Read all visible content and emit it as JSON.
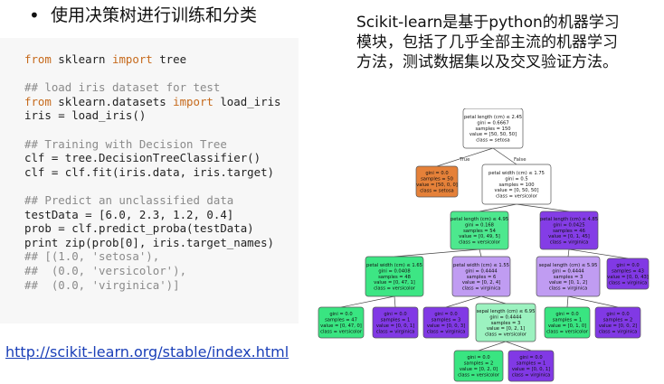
{
  "slide": {
    "bullet": "•",
    "title": "使用决策树进行训练和分类",
    "description_lines": [
      "Scikit-learn是基于python的机器学习",
      "模块，包括了几乎全部主流的机器学习",
      "方法，测试数据集以及交叉验证方法。"
    ],
    "link": "http://scikit-learn.org/stable/index.html"
  },
  "code": [
    [
      {
        "t": "from",
        "c": "kw"
      },
      {
        "t": " sklearn "
      },
      {
        "t": "import",
        "c": "kw"
      },
      {
        "t": " tree"
      }
    ],
    [],
    [
      {
        "t": "## load iris dataset for test",
        "c": "cm"
      }
    ],
    [
      {
        "t": "from",
        "c": "kw"
      },
      {
        "t": " sklearn.datasets "
      },
      {
        "t": "import",
        "c": "kw"
      },
      {
        "t": " load_iris"
      }
    ],
    [
      {
        "t": "iris = load_iris()"
      }
    ],
    [],
    [
      {
        "t": "## Training with Decision Tree",
        "c": "cm"
      }
    ],
    [
      {
        "t": "clf = tree.DecisionTreeClassifier()"
      }
    ],
    [
      {
        "t": "clf = clf.fit(iris.data, iris.target)"
      }
    ],
    [],
    [
      {
        "t": "## Predict an unclassified data",
        "c": "cm"
      }
    ],
    [
      {
        "t": "testData = [6.0, 2.3, 1.2, 0.4]"
      }
    ],
    [
      {
        "t": "prob = clf.predict_proba(testData)"
      }
    ],
    [
      {
        "t": "print zip(prob[0], iris.target_names)"
      }
    ],
    [
      {
        "t": "## [(1.0, 'setosa'),",
        "c": "cm"
      }
    ],
    [
      {
        "t": "##  (0.0, 'versicolor'),",
        "c": "cm"
      }
    ],
    [
      {
        "t": "##  (0.0, 'virginica')]",
        "c": "cm"
      }
    ]
  ],
  "tree": {
    "edge_labels": {
      "true": "True",
      "false": "False"
    },
    "nodes": [
      {
        "id": "n0",
        "lines": [
          "petal length (cm) ≤ 2.45",
          "gini = 0.6667",
          "samples = 150",
          "value = [50, 50, 50]",
          "class = setosa"
        ],
        "fill": "#ffffff"
      },
      {
        "id": "n1",
        "lines": [
          "gini = 0.0",
          "samples = 50",
          "value = [50, 0, 0]",
          "class = setosa"
        ],
        "fill": "#e58139"
      },
      {
        "id": "n2",
        "lines": [
          "petal width (cm) ≤ 1.75",
          "gini = 0.5",
          "samples = 100",
          "value = [0, 50, 50]",
          "class = versicolor"
        ],
        "fill": "#ffffff"
      },
      {
        "id": "n3",
        "lines": [
          "petal length (cm) ≤ 4.95",
          "gini = 0.168",
          "samples = 54",
          "value = [0, 49, 5]",
          "class = versicolor"
        ],
        "fill": "#4de88e"
      },
      {
        "id": "n4",
        "lines": [
          "petal length (cm) ≤ 4.85",
          "gini = 0.0425",
          "samples = 46",
          "value = [0, 1, 45]",
          "class = virginica"
        ],
        "fill": "#843de6"
      },
      {
        "id": "n5",
        "lines": [
          "petal width (cm) ≤ 1.65",
          "gini = 0.0408",
          "samples = 48",
          "value = [0, 47, 1]",
          "class = versicolor"
        ],
        "fill": "#3de684"
      },
      {
        "id": "n6",
        "lines": [
          "petal width (cm) ≤ 1.55",
          "gini = 0.4444",
          "samples = 6",
          "value = [0, 2, 4]",
          "class = virginica"
        ],
        "fill": "#c09cf2"
      },
      {
        "id": "n7",
        "lines": [
          "sepal length (cm) ≤ 5.95",
          "gini = 0.4444",
          "samples = 3",
          "value = [0, 1, 2]",
          "class = virginica"
        ],
        "fill": "#c09cf2"
      },
      {
        "id": "n8",
        "lines": [
          "gini = 0.0",
          "samples = 43",
          "value = [0, 0, 43]",
          "class = virginica"
        ],
        "fill": "#8139e5"
      },
      {
        "id": "n9",
        "lines": [
          "gini = 0.0",
          "samples = 47",
          "value = [0, 47, 0]",
          "class = versicolor"
        ],
        "fill": "#39e581"
      },
      {
        "id": "n10",
        "lines": [
          "gini = 0.0",
          "samples = 1",
          "value = [0, 0, 1]",
          "class = virginica"
        ],
        "fill": "#8139e5"
      },
      {
        "id": "n11",
        "lines": [
          "gini = 0.0",
          "samples = 3",
          "value = [0, 0, 3]",
          "class = virginica"
        ],
        "fill": "#8139e5"
      },
      {
        "id": "n12",
        "lines": [
          "sepal length (cm) ≤ 6.95",
          "gini = 0.4444",
          "samples = 3",
          "value = [0, 2, 1]",
          "class = versicolor"
        ],
        "fill": "#9cf2c0"
      },
      {
        "id": "n13",
        "lines": [
          "gini = 0.0",
          "samples = 1",
          "value = [0, 1, 0]",
          "class = versicolor"
        ],
        "fill": "#39e581"
      },
      {
        "id": "n14",
        "lines": [
          "gini = 0.0",
          "samples = 2",
          "value = [0, 0, 2]",
          "class = virginica"
        ],
        "fill": "#8139e5"
      },
      {
        "id": "n15",
        "lines": [
          "gini = 0.0",
          "samples = 2",
          "value = [0, 2, 0]",
          "class = versicolor"
        ],
        "fill": "#39e581"
      },
      {
        "id": "n16",
        "lines": [
          "gini = 0.0",
          "samples = 1",
          "value = [0, 0, 1]",
          "class = virginica"
        ],
        "fill": "#8139e5"
      }
    ],
    "edges": [
      [
        "n0",
        "n1"
      ],
      [
        "n0",
        "n2"
      ],
      [
        "n2",
        "n3"
      ],
      [
        "n2",
        "n4"
      ],
      [
        "n3",
        "n5"
      ],
      [
        "n3",
        "n6"
      ],
      [
        "n4",
        "n7"
      ],
      [
        "n4",
        "n8"
      ],
      [
        "n5",
        "n9"
      ],
      [
        "n5",
        "n10"
      ],
      [
        "n6",
        "n11"
      ],
      [
        "n6",
        "n12"
      ],
      [
        "n7",
        "n13"
      ],
      [
        "n7",
        "n14"
      ],
      [
        "n12",
        "n15"
      ],
      [
        "n12",
        "n16"
      ]
    ]
  }
}
